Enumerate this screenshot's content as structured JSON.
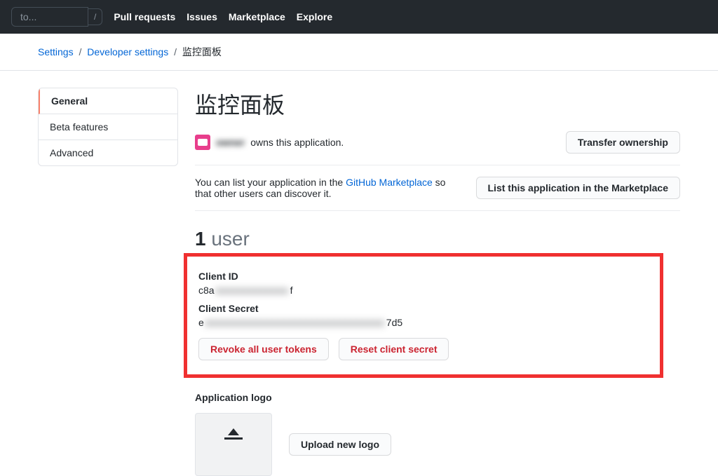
{
  "topbar": {
    "search_placeholder": "to...",
    "slash": "/",
    "nav": {
      "pull_requests": "Pull requests",
      "issues": "Issues",
      "marketplace": "Marketplace",
      "explore": "Explore"
    }
  },
  "breadcrumbs": {
    "settings": "Settings",
    "developer_settings": "Developer settings",
    "current": "监控面板"
  },
  "sidebar": {
    "items": [
      "General",
      "Beta features",
      "Advanced"
    ]
  },
  "page": {
    "title": "监控面板",
    "owner_name_masked": "owner",
    "owns_text": " owns this application.",
    "transfer_btn": "Transfer ownership",
    "marketplace_pre": "You can list your application in the ",
    "marketplace_link": "GitHub Marketplace",
    "marketplace_post": " so that other users can discover it.",
    "list_btn": "List this application in the Marketplace",
    "user_count": "1",
    "user_label": " user",
    "client_id_label": "Client ID",
    "client_id_prefix": "c8a",
    "client_id_masked": "xxxxxxxxxxxxx",
    "client_id_suffix": "f",
    "client_secret_label": "Client Secret",
    "client_secret_prefix": "e",
    "client_secret_masked": "xxxxxxxxxxxxxxxxxxxxxxxxxxxxxxxx",
    "client_secret_suffix": "7d5",
    "revoke_btn": "Revoke all user tokens",
    "reset_btn": "Reset client secret",
    "app_logo_heading": "Application logo",
    "upload_btn": "Upload new logo"
  }
}
